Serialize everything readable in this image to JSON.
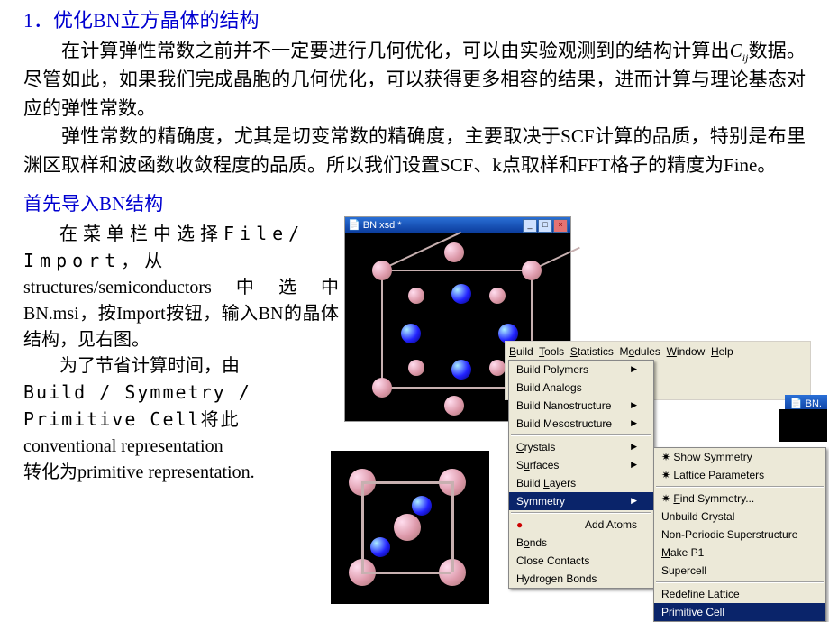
{
  "heading1": "1．优化BN立方晶体的结构",
  "para1_a": "在计算弹性常数之前并不一定要进行几何优化，可以由实验观测到的结构计算出",
  "cij_c": "C",
  "cij_ij": "ij",
  "para1_b": "数据。尽管如此，如果我们完成晶胞的几何优化，可以获得更多相容的结果，进而计算与理论基态对应的弹性常数。",
  "para2": "弹性常数的精确度，尤其是切变常数的精确度，主要取决于SCF计算的品质，特别是布里渊区取样和波函数收敛程度的品质。所以我们设置SCF、k点取样和FFT格子的精度为Fine。",
  "heading2": "首先导入BN结构",
  "left_p1_a": "在菜单栏中选择File/",
  "left_p1_b": "Import，从",
  "left_p1_c": "structures/semiconductors中选中BN.msi，按Import按钮，输入BN的晶体结构，见右图。",
  "left_p2_a": "为了节省计算时间，由",
  "left_p2_b": "Build / Symmetry / ",
  "left_p2_c": "Primitive Cell将此",
  "left_p2_d": "conventional representation",
  "left_p2_e": "转化为primitive representation.",
  "viewer1_title": "BN.xsd *",
  "menubar": {
    "build": "Build",
    "tools": "Tools",
    "statistics": "Statistics",
    "modules": "Modules",
    "window": "Window",
    "help": "Help"
  },
  "build_menu": {
    "polymers": "Build Polymers",
    "analogs": "Build Analogs",
    "nano": "Build Nanostructure",
    "meso": "Build Mesostructure",
    "crystals": "Crystals",
    "surfaces": "Surfaces",
    "layers": "Build Layers",
    "symmetry": "Symmetry",
    "add_atoms": "Add Atoms",
    "bonds": "Bonds",
    "close_contacts": "Close Contacts",
    "hbonds": "Hydrogen Bonds"
  },
  "symmetry_menu": {
    "show": "Show Symmetry",
    "lattice_params": "Lattice Parameters",
    "find": "Find Symmetry...",
    "unbuild": "Unbuild Crystal",
    "nonperiodic": "Non-Periodic Superstructure",
    "make_p1": "Make P1",
    "supercell": "Supercell",
    "redefine": "Redefine Lattice",
    "primitive": "Primitive Cell"
  },
  "bn_tab": "BN."
}
